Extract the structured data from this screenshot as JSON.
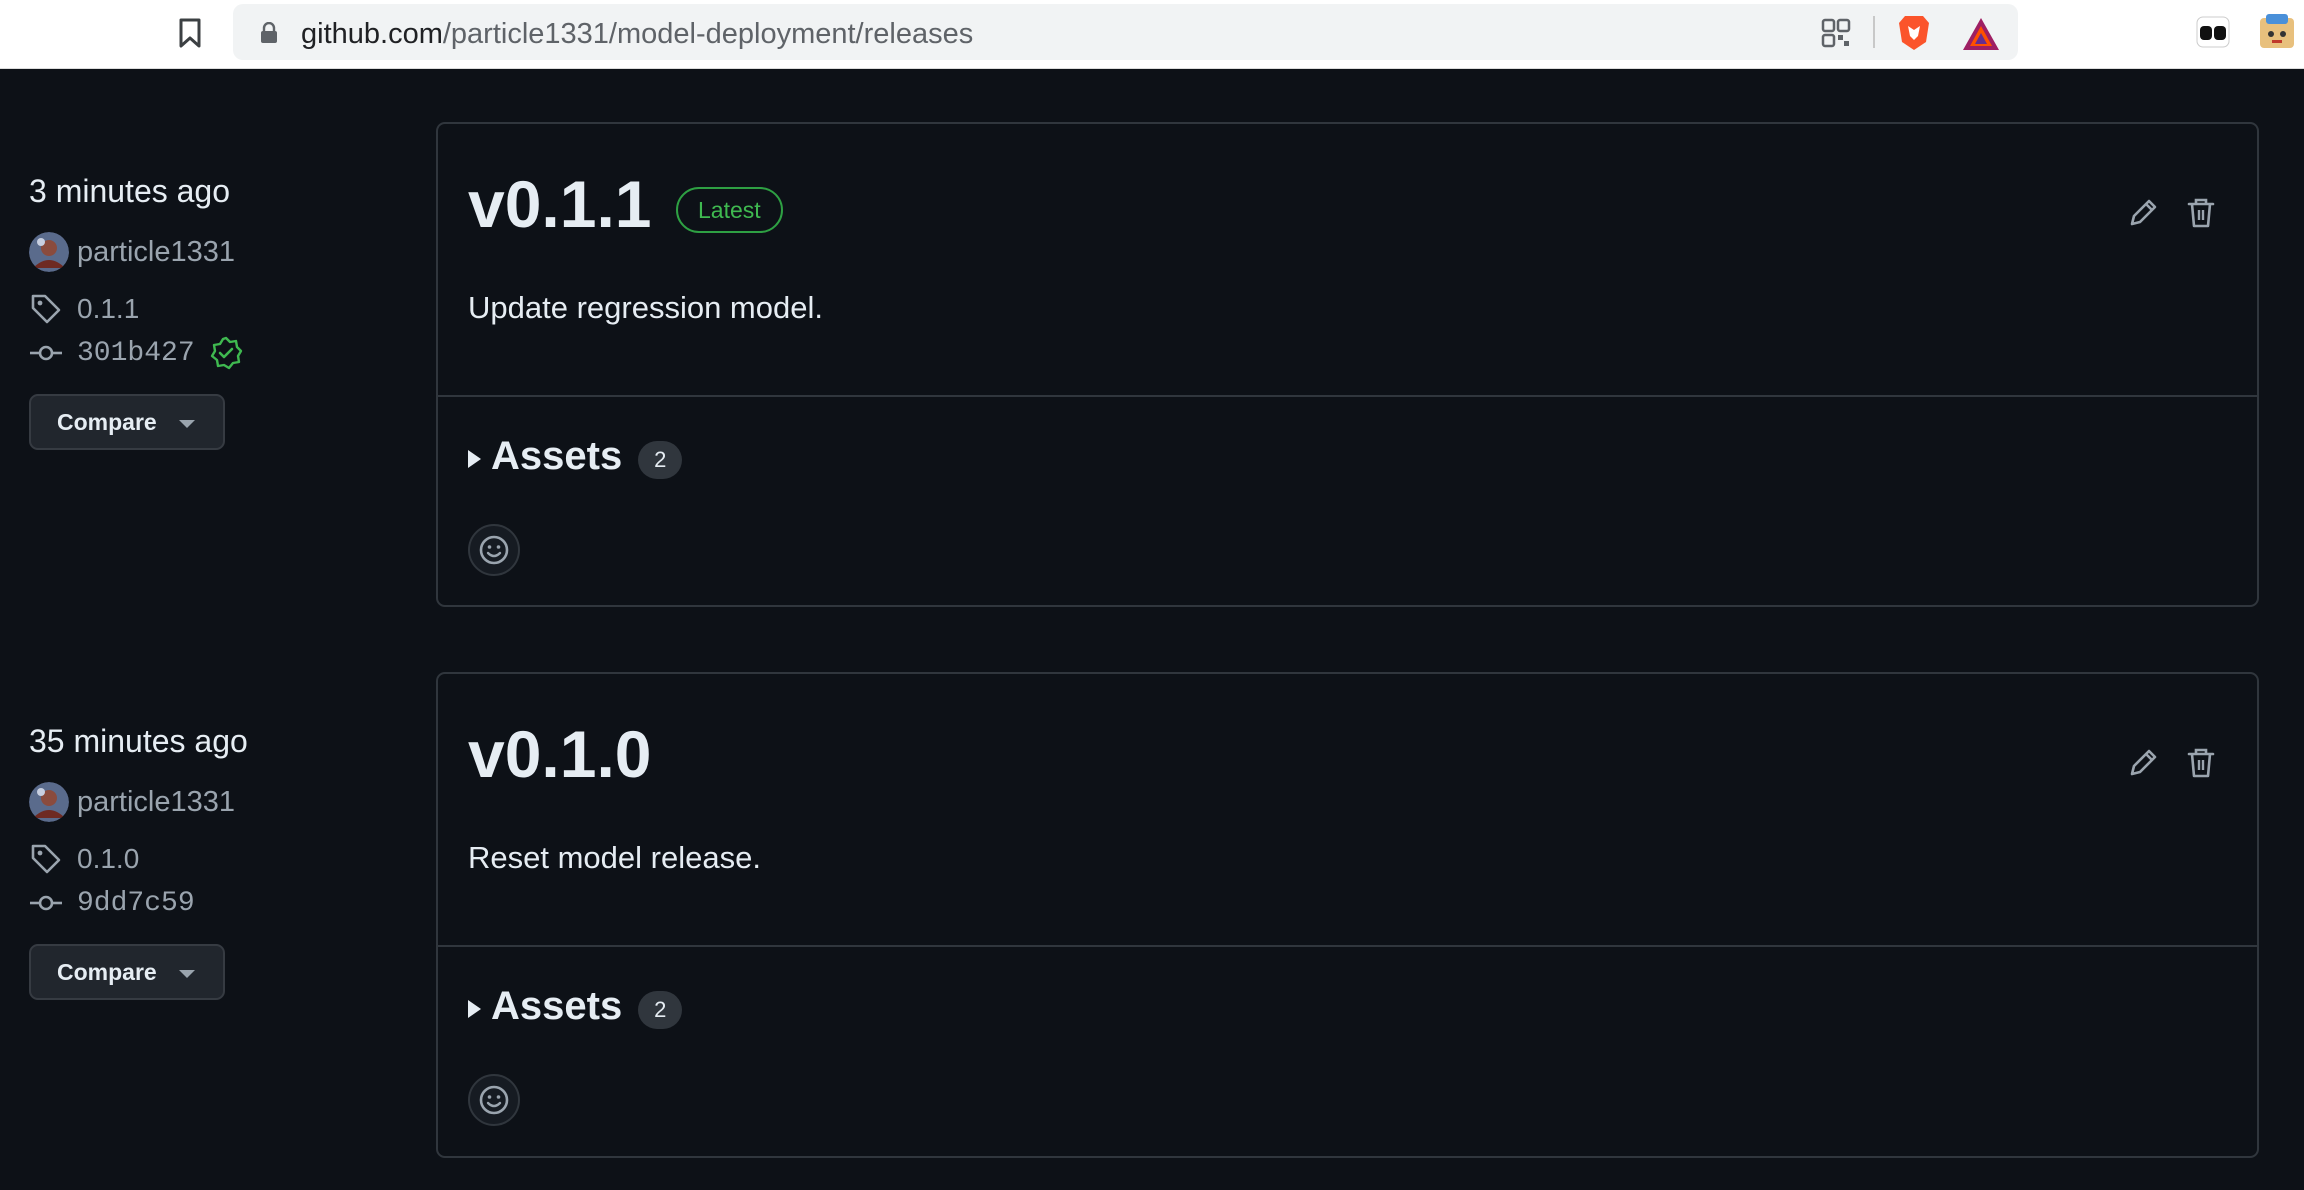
{
  "browser": {
    "url_host": "github.com",
    "url_path": "/particle1331/model-deployment/releases",
    "icons": [
      "bookmark-icon",
      "lock-icon",
      "qr-code-icon",
      "brave-shield-icon",
      "brave-rewards-icon",
      "extension-icon",
      "extension-icon-2"
    ]
  },
  "colors": {
    "page_bg": "#0d1117",
    "border": "#30363d",
    "latest_green": "#3fb950",
    "verified_green": "#3fb950"
  },
  "releases": [
    {
      "time": "3 minutes ago",
      "author": "particle1331",
      "tag": "0.1.1",
      "commit": "301b427",
      "verified": true,
      "compare_label": "Compare",
      "title": "v0.1.1",
      "badge": "Latest",
      "description": "Update regression model.",
      "assets_label": "Assets",
      "assets_count": "2"
    },
    {
      "time": "35 minutes ago",
      "author": "particle1331",
      "tag": "0.1.0",
      "commit": "9dd7c59",
      "verified": false,
      "compare_label": "Compare",
      "title": "v0.1.0",
      "badge": "",
      "description": "Reset model release.",
      "assets_label": "Assets",
      "assets_count": "2"
    }
  ]
}
